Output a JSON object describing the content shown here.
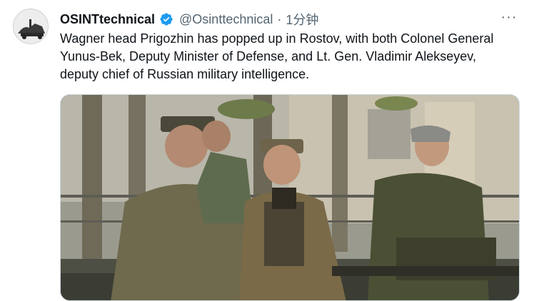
{
  "tweet": {
    "author_name": "OSINTtechnical",
    "handle": "@Osinttechnical",
    "separator": "·",
    "time": "1分钟",
    "text": "Wagner head Prigozhin has popped up in Rostov, with both Colonel General Yunus-Bek, Deputy Minister of Defense, and Lt. Gen. Vladimir Alekseyev, deputy chief of Russian military intelligence.",
    "more_label": "···"
  },
  "colors": {
    "verified": "#1d9bf0",
    "secondary_text": "#536471",
    "primary_text": "#0f1419"
  },
  "icons": {
    "verified": "verified-badge-icon",
    "more": "more-horizontal-icon",
    "avatar": "avatar-image"
  }
}
